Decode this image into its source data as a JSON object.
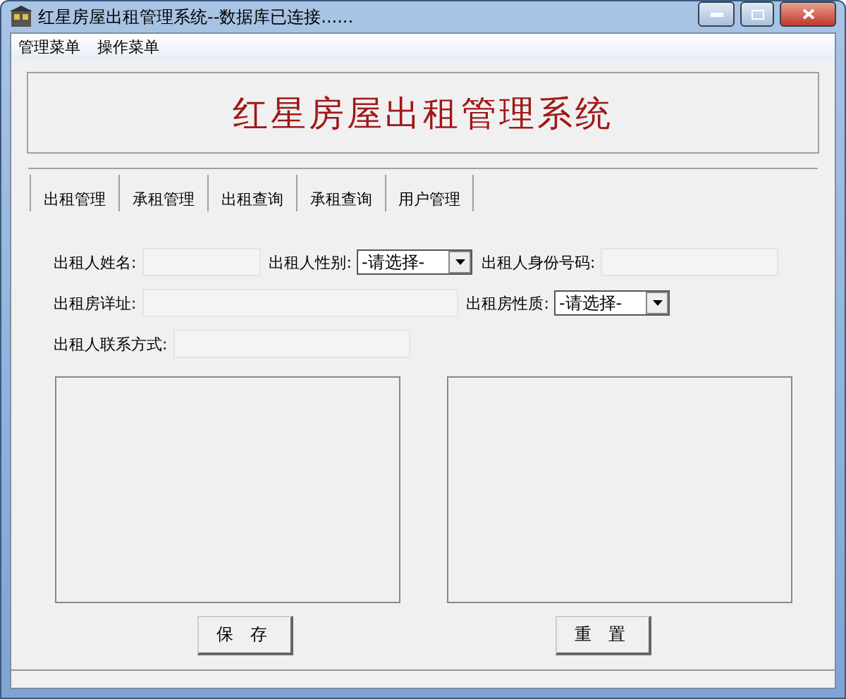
{
  "window": {
    "title": "红星房屋出租管理系统--数据库已连接......"
  },
  "menu": [
    "管理菜单",
    "操作菜单"
  ],
  "banner": "红星房屋出租管理系统",
  "tabs": [
    "出租管理",
    "承租管理",
    "出租查询",
    "承租查询",
    "用户管理"
  ],
  "form": {
    "name_label": "出租人姓名:",
    "gender_label": "出租人性别:",
    "gender_select": "-请选择-",
    "id_label": "出租人身份号码:",
    "address_label": "出租房详址:",
    "type_label": "出租房性质:",
    "type_select": "-请选择-",
    "contact_label": "出租人联系方式:"
  },
  "buttons": [
    "保 存",
    "重 置"
  ]
}
